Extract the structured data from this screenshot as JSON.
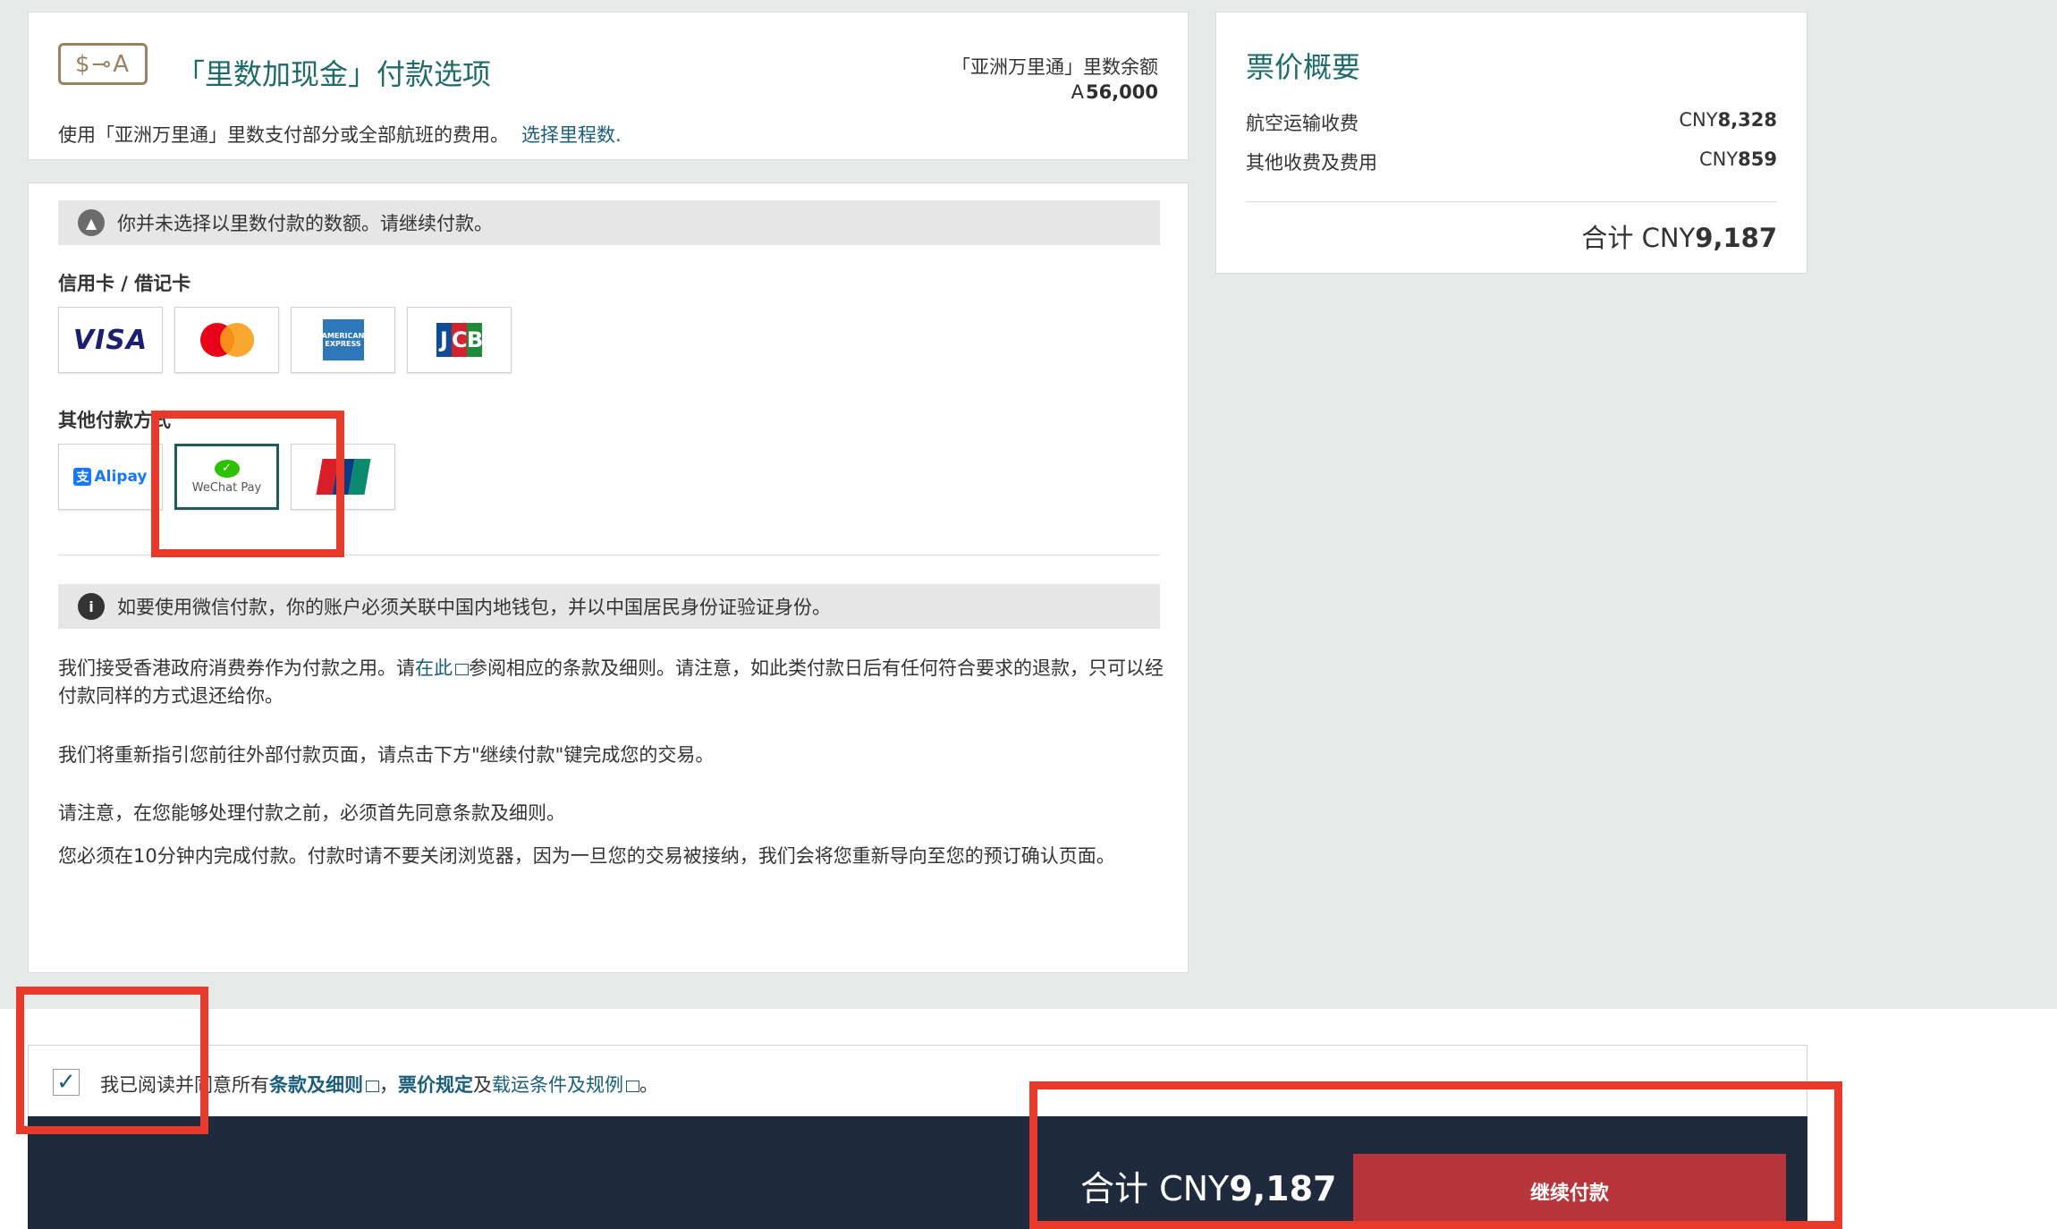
{
  "miles_option": {
    "icon_text": "$⊸A",
    "title": "「里数加现金」付款选项",
    "description": "使用「亚洲万里通」里数支付部分或全部航班的费用。",
    "select_link": "选择里程数.",
    "balance_label": "「亚洲万里通」里数余额",
    "balance_symbol": "A",
    "balance_value": "56,000"
  },
  "payment": {
    "notice_text": "你并未选择以里数付款的数额。请继续付款。",
    "cards_label": "信用卡 / 借记卡",
    "card_methods": [
      {
        "name": "VISA"
      },
      {
        "name": "Mastercard"
      },
      {
        "name": "American Express",
        "text": "AMERICAN EXPRESS"
      },
      {
        "name": "JCB",
        "letters": [
          "J",
          "C",
          "B"
        ]
      }
    ],
    "other_label": "其他付款方式",
    "other_methods": [
      {
        "name": "Alipay",
        "icon_char": "支",
        "text": "Alipay"
      },
      {
        "name": "WeChat Pay",
        "text": "WeChat Pay",
        "selected": true
      },
      {
        "name": "UnionPay",
        "text": "UnionPay"
      }
    ],
    "info_text": "如要使用微信付款，你的账户必须关联中国内地钱包，并以中国居民身份证验证身份。",
    "voucher_text_1": "我们接受香港政府消费券作为付款之用。请",
    "voucher_link": "在此",
    "voucher_text_2": "参阅相应的条款及细则。请注意，如此类付款日后有任何符合要求的退款，只可以经付款同样的方式退还给你。",
    "redirect_text": "我们将重新指引您前往外部付款页面，请点击下方\"继续付款\"键完成您的交易。",
    "agree_note": "请注意，在您能够处理付款之前，必须首先同意条款及细则。",
    "time_note": "您必须在10分钟内完成付款。付款时请不要关闭浏览器，因为一旦您的交易被接纳，我们会将您重新导向至您的预订确认页面。"
  },
  "summary": {
    "title": "票价概要",
    "rows": [
      {
        "label": "航空运输收费",
        "currency": "CNY",
        "amount": "8,328"
      },
      {
        "label": "其他收费及费用",
        "currency": "CNY",
        "amount": "859"
      }
    ],
    "total_prefix": "合计 CNY",
    "total_amount": "9,187"
  },
  "terms": {
    "checked": true,
    "prefix": "我已阅读并同意所有",
    "link1": "条款及细则",
    "sep1": "，",
    "link2": "票价规定",
    "sep2": "及",
    "link3": "载运条件及规例",
    "suffix": "。"
  },
  "footer": {
    "total_prefix": "合计 CNY",
    "total_amount": "9,187",
    "continue_label": "继续付款"
  },
  "colors": {
    "accent_teal": "#1f6b6a",
    "link_blue": "#1a5e7c",
    "button_red": "#b8363b",
    "footer_navy": "#1f2b3c",
    "annotation_red": "#e8392a"
  }
}
